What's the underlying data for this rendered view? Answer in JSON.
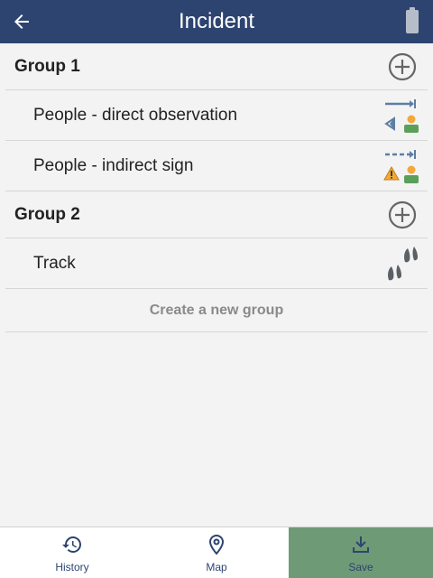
{
  "header": {
    "title": "Incident",
    "back_icon": "arrow-left-icon",
    "battery_icon": "battery-icon"
  },
  "groups": [
    {
      "label": "Group 1",
      "items": [
        {
          "label": "People - direct observation",
          "icon": "people-direct-observation-icon"
        },
        {
          "label": "People - indirect sign",
          "icon": "people-indirect-sign-icon"
        }
      ]
    },
    {
      "label": "Group 2",
      "items": [
        {
          "label": "Track",
          "icon": "hoof-track-icon"
        }
      ]
    }
  ],
  "create_group_label": "Create a new group",
  "bottom_nav": {
    "items": [
      {
        "label": "History",
        "icon": "history-icon",
        "active": false
      },
      {
        "label": "Map",
        "icon": "map-pin-icon",
        "active": false
      },
      {
        "label": "Save",
        "icon": "download-icon",
        "active": true
      }
    ]
  },
  "colors": {
    "header_bg": "#2e4470",
    "page_bg": "#f3f3f3",
    "active_nav_bg": "#6f9a76",
    "nav_text": "#2e4470",
    "icon_blue": "#5e7ea3",
    "icon_green": "#5aa05a",
    "icon_orange": "#f0a93a"
  }
}
